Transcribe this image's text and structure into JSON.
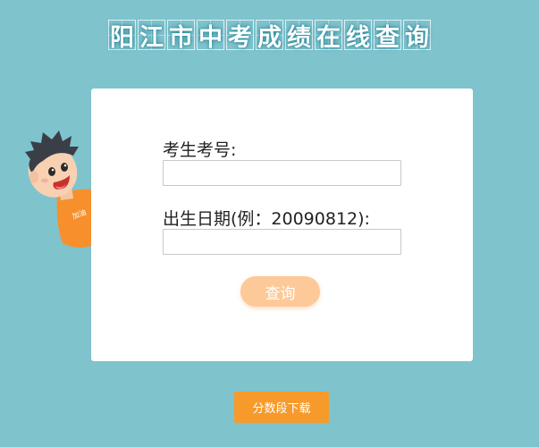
{
  "header": {
    "title_chars": [
      "阳",
      "江",
      "市",
      "中",
      "考",
      "成",
      "绩",
      "在",
      "线",
      "查",
      "询"
    ]
  },
  "form": {
    "exam_no_label": "考生考号:",
    "exam_no_value": "",
    "birth_label": "出生日期(例：20090812):",
    "birth_value": "",
    "query_label": "查询"
  },
  "footer": {
    "download_label": "分数段下载"
  },
  "mascot": {
    "shirt_text": "加油"
  },
  "colors": {
    "background": "#7fc3cd",
    "card": "#ffffff",
    "query_button": "#fdc998",
    "download_button": "#f69b2b",
    "mascot_shirt": "#f7902c"
  }
}
